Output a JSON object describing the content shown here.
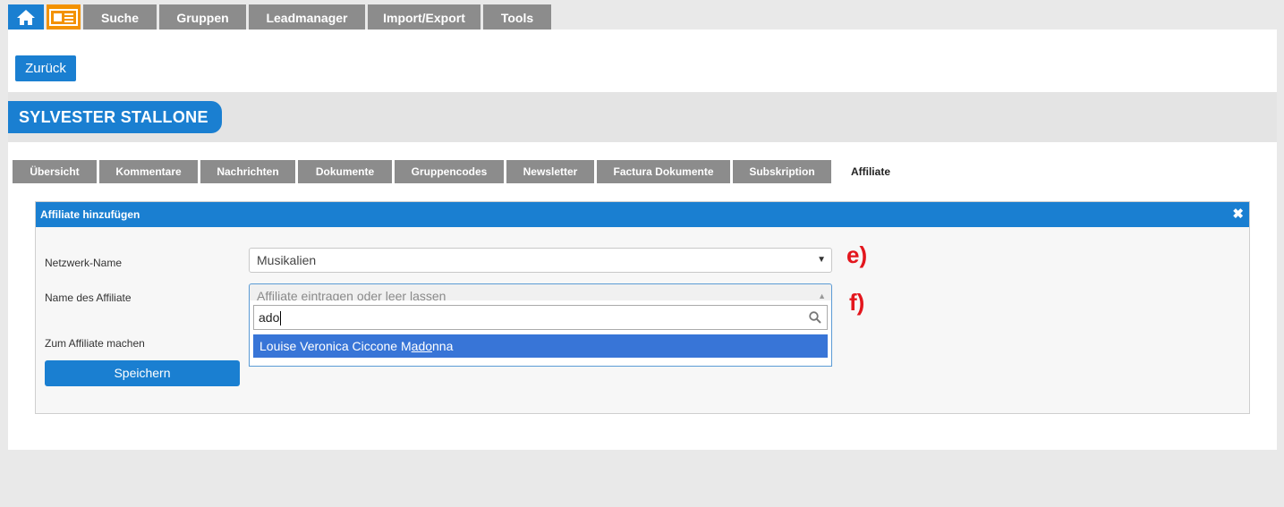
{
  "nav": {
    "home_icon": "home-icon",
    "contact_icon": "contact-card-icon",
    "tabs": [
      "Suche",
      "Gruppen",
      "Leadmanager",
      "Import/Export",
      "Tools"
    ]
  },
  "back_label": "Zurück",
  "contact_name": "SYLVESTER STALLONE",
  "subtabs": [
    "Übersicht",
    "Kommentare",
    "Nachrichten",
    "Dokumente",
    "Gruppencodes",
    "Newsletter",
    "Factura Dokumente",
    "Subskription",
    "Affiliate"
  ],
  "active_subtab": "Affiliate",
  "affiliate": {
    "title": "Affiliate hinzufügen",
    "close_icon": "close-icon",
    "network_label": "Netzwerk-Name",
    "network_value": "Musikalien",
    "affiliate_label": "Name des Affiliate",
    "affiliate_placeholder": "Affiliate eintragen oder leer lassen",
    "search_query": "ado",
    "option_before": "Louise Veronica Ciccone M",
    "option_match": "ado",
    "option_after": "nna",
    "make_affiliate_label": "Zum Affiliate machen",
    "save_label": "Speichern"
  },
  "annotations": [
    "e)",
    "f)"
  ],
  "colors": {
    "primary": "#1a7fd1",
    "orange": "#f39200",
    "tab_gray": "#8c8c8c",
    "highlight": "#3875d7",
    "annotation_red": "#e3161d"
  }
}
